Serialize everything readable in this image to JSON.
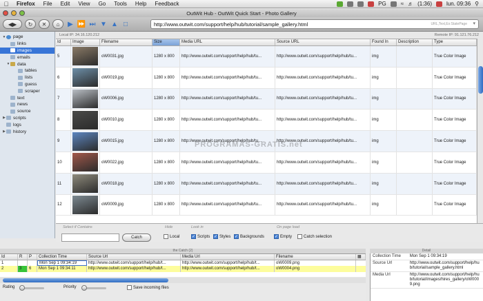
{
  "menubar": {
    "app": "Firefox",
    "items": [
      "File",
      "Edit",
      "View",
      "Go",
      "Tools",
      "Help",
      "Feedback"
    ],
    "tray_pg": "PG",
    "battery": "(1:36)",
    "clock": "lun. 09:36"
  },
  "window": {
    "title": "OutWit Hub - OutWit Quick Start - Photo Gallery"
  },
  "toolbar": {
    "url": "http://www.outwit.com/support/help/hub/tutorial/sample_gallery.html",
    "url_hint": "URL,Text,Ex:StatePage"
  },
  "ipbar": {
    "local": "Local IP: 34.16.120.212",
    "remote": "Remote IP: 91.121.76.212"
  },
  "sidebar": {
    "items": [
      {
        "label": "page"
      },
      {
        "label": "links"
      },
      {
        "label": "images"
      },
      {
        "label": "emails"
      },
      {
        "label": "data"
      },
      {
        "label": "tables"
      },
      {
        "label": "lists"
      },
      {
        "label": "guess"
      },
      {
        "label": "scraper"
      },
      {
        "label": "text"
      },
      {
        "label": "news"
      },
      {
        "label": "source"
      },
      {
        "label": "scripts"
      },
      {
        "label": "logs"
      },
      {
        "label": "history"
      }
    ]
  },
  "grid": {
    "headers": {
      "id": "Id",
      "image": "Image",
      "filename": "Filename",
      "size": "Size",
      "media_url": "Media URL",
      "source_url": "Source URL",
      "found_in": "Found In",
      "description": "Description",
      "type": "Type"
    },
    "rows": [
      {
        "id": "5",
        "filename": "oW0031.jpg",
        "size": "1280 x 800",
        "media_url": "http://www.outwit.com/support/help/hub/tu...",
        "source_url": "http://www.outwit.com/support/help/hub/tu...",
        "found_in": "img",
        "description": "",
        "type": "True Color Image",
        "thumb": "#8a7a66"
      },
      {
        "id": "6",
        "filename": "oW0019.jpg",
        "size": "1280 x 800",
        "media_url": "http://www.outwit.com/support/help/hub/tu...",
        "source_url": "http://www.outwit.com/support/help/hub/tu...",
        "found_in": "img",
        "description": "",
        "type": "True Color Image",
        "thumb": "#6d8fa8"
      },
      {
        "id": "7",
        "filename": "oW0006.jpg",
        "size": "1280 x 800",
        "media_url": "http://www.outwit.com/support/help/hub/tu...",
        "source_url": "http://www.outwit.com/support/help/hub/tu...",
        "found_in": "img",
        "description": "",
        "type": "True Color Image",
        "thumb": "#b9bec4"
      },
      {
        "id": "8",
        "filename": "oW0010.jpg",
        "size": "1280 x 800",
        "media_url": "http://www.outwit.com/support/help/hub/tu...",
        "source_url": "http://www.outwit.com/support/help/hub/tu...",
        "found_in": "img",
        "description": "",
        "type": "True Color Image",
        "thumb": "#4a4a48"
      },
      {
        "id": "9",
        "filename": "oW0015.jpg",
        "size": "1280 x 800",
        "media_url": "http://www.outwit.com/support/help/hub/tu...",
        "source_url": "http://www.outwit.com/support/help/hub/tu...",
        "found_in": "img",
        "description": "",
        "type": "True Color Image",
        "thumb": "#5d86c0"
      },
      {
        "id": "10",
        "filename": "oW0022.jpg",
        "size": "1280 x 800",
        "media_url": "http://www.outwit.com/support/help/hub/tu...",
        "source_url": "http://www.outwit.com/support/help/hub/tu...",
        "found_in": "img",
        "description": "",
        "type": "True Color Image",
        "thumb": "#a2584a"
      },
      {
        "id": "11",
        "filename": "oW0018.jpg",
        "size": "1280 x 800",
        "media_url": "http://www.outwit.com/support/help/hub/tu...",
        "source_url": "http://www.outwit.com/support/help/hub/tu...",
        "found_in": "img",
        "description": "",
        "type": "True Color Image",
        "thumb": "#8f8b7c"
      },
      {
        "id": "12",
        "filename": "oW0009.jpg",
        "size": "1280 x 800",
        "media_url": "http://www.outwit.com/support/help/hub/tu...",
        "source_url": "http://www.outwit.com/support/help/hub/tu...",
        "found_in": "img",
        "description": "",
        "type": "True Color Image",
        "thumb": "#7d8a92"
      }
    ]
  },
  "watermark": "PROGRAMAS-GRATIS.net",
  "filters": {
    "select_label": "Select if Contains",
    "catch_button": "Catch",
    "hide_label": "Hide",
    "local": "Local",
    "look_label": "Look in",
    "scripts": "Scripts",
    "styles": "Styles",
    "backgrounds": "Backgrounds",
    "onload_label": "On page load",
    "empty": "Empty",
    "catch_selection": "Catch selection"
  },
  "catch": {
    "title": "the Catch (2)",
    "headers": {
      "id": "Id",
      "r": "R",
      "p": "P",
      "collection_time": "Collection Time",
      "source_url": "Source Url",
      "media_url": "Media Url",
      "filename": "Filename"
    },
    "rows": [
      {
        "id": "1",
        "r": "",
        "p": "",
        "collection_time": "Mon Sep  1 09:34:19",
        "source_url": "http://www.outwit.com/support/help/hub/t...",
        "media_url": "http://www.outwit.com/support/help/hub/t...",
        "filename": "oW0009.png"
      },
      {
        "id": "2",
        "r": "3",
        "p": "6",
        "collection_time": "Mon Sep  1 09:34:11",
        "source_url": "http://www.outwit.com/support/help/hub/t...",
        "media_url": "http://www.outwit.com/support/help/hub/t...",
        "filename": "oW0004.png"
      }
    ]
  },
  "detail": {
    "title": "Detail",
    "rows": [
      {
        "key": "Collection Time",
        "value": "Mon Sep 1 09:34:19"
      },
      {
        "key": "Source Url",
        "value": "http://www.outwit.com/support/help/hub/tutorial/sample_gallery.html"
      },
      {
        "key": "Media Url",
        "value": "http://www.outwit.com/support/help/hub/tutorial/images/hires_gallery/oW0009.png"
      }
    ]
  },
  "bottom": {
    "rating": "Rating",
    "priority": "Priority",
    "save_incoming": "Save incoming files"
  }
}
